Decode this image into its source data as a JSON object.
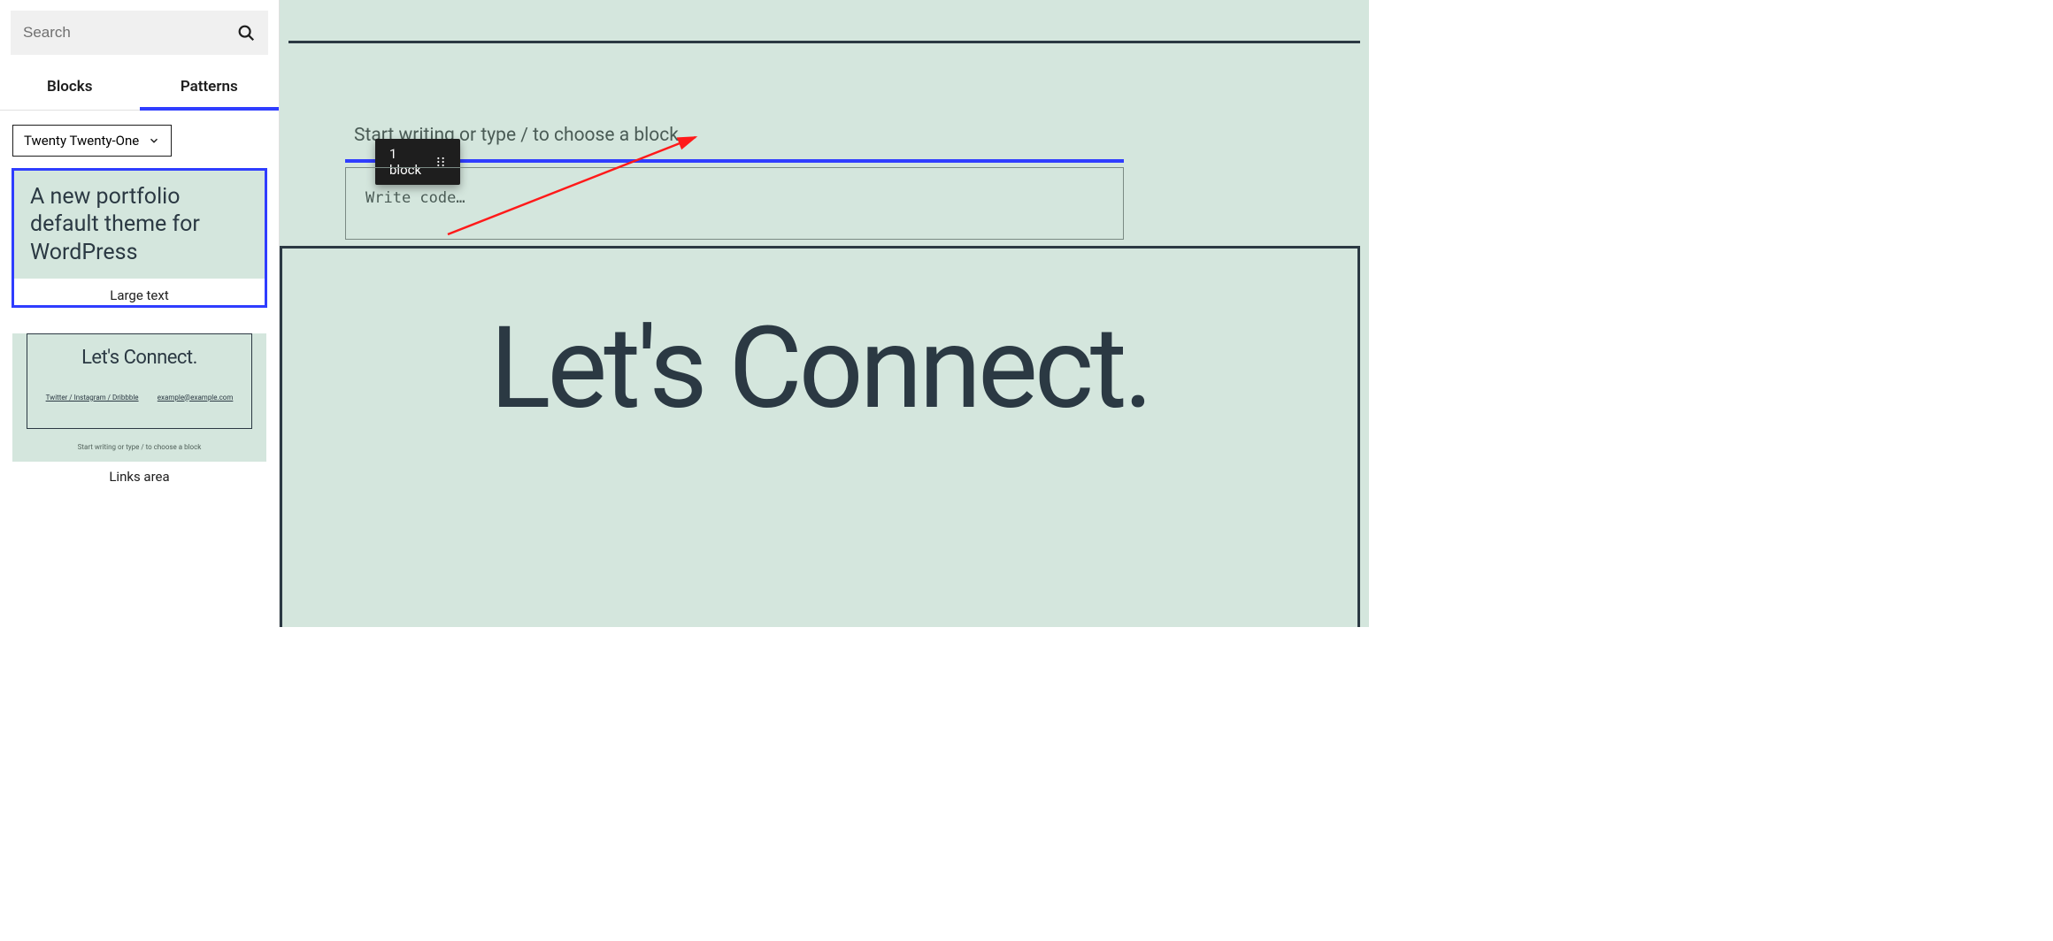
{
  "search": {
    "placeholder": "Search"
  },
  "tabs": {
    "blocks": "Blocks",
    "patterns": "Patterns"
  },
  "category_select": {
    "value": "Twenty Twenty-One"
  },
  "patterns": {
    "large_text": {
      "label": "Large text",
      "content": "A new portfolio default theme for WordPress"
    },
    "links_area": {
      "label": "Links area",
      "title": "Let's Connect.",
      "links": "Twitter / Instagram / Dribbble",
      "email": "example@example.com",
      "placeholder": "Start writing or type / to choose a block"
    }
  },
  "editor": {
    "prompt": "Start writing or type / to choose a block",
    "code_placeholder": "Write code…",
    "big_title": "Let's Connect."
  },
  "drag_chip": {
    "line1": "1",
    "line2": "block"
  }
}
